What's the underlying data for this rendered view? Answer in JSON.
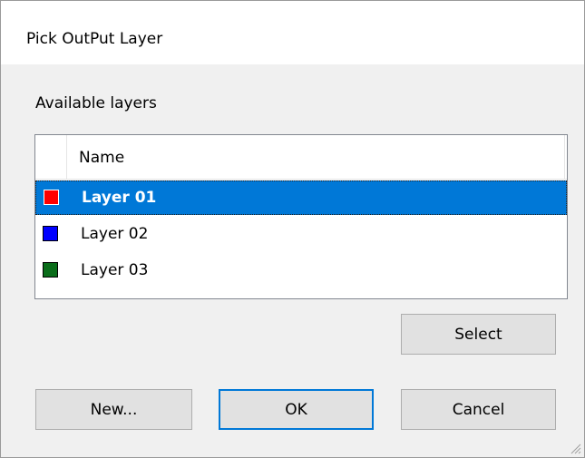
{
  "window": {
    "title": "Pick OutPut Layer"
  },
  "section_label": "Available layers",
  "list": {
    "column_header": "Name",
    "rows": [
      {
        "label": "Layer 01",
        "color": "#ff0000",
        "selected": true
      },
      {
        "label": "Layer 02",
        "color": "#0000ff",
        "selected": false
      },
      {
        "label": "Layer 03",
        "color": "#0a6d1a",
        "selected": false
      }
    ]
  },
  "buttons": {
    "select": "Select",
    "new": "New...",
    "ok": "OK",
    "cancel": "Cancel"
  },
  "colors": {
    "selection": "#0078d7",
    "dialog_background": "#f0f0f0"
  },
  "icons": {
    "resize_grip": "resize-grip-icon"
  }
}
